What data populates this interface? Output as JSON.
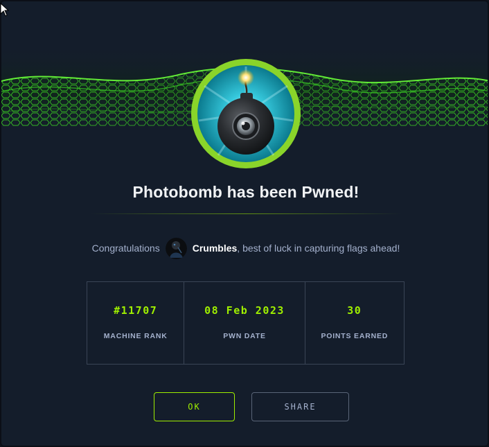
{
  "modal": {
    "title": "Photobomb has been Pwned!",
    "congrats_prefix": "Congratulations",
    "username": "Crumbles",
    "congrats_suffix": ", best of luck in capturing flags ahead!"
  },
  "stats": [
    {
      "value": "#11707",
      "label": "MACHINE RANK"
    },
    {
      "value": "08 Feb 2023",
      "label": "PWN DATE"
    },
    {
      "value": "30",
      "label": "POINTS EARNED"
    }
  ],
  "buttons": {
    "ok_label": "OK",
    "share_label": "SHARE"
  },
  "colors": {
    "background": "#141d2b",
    "accent": "#9fef00",
    "muted_text": "#a4b1cd"
  },
  "icons": {
    "machine_avatar": "bomb-camera-icon",
    "user_avatar": "user-avatar",
    "cursor": "mouse-cursor-icon"
  }
}
